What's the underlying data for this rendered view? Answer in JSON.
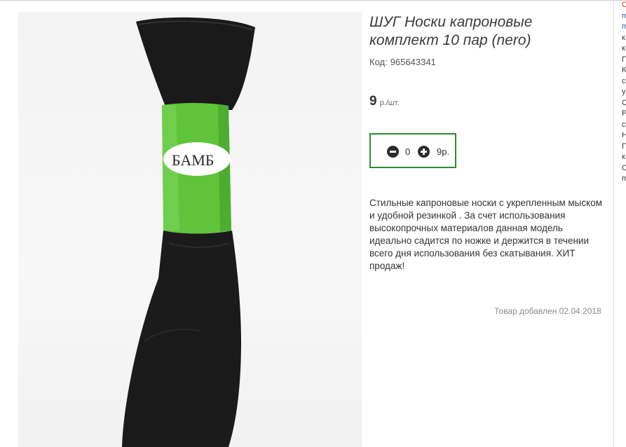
{
  "product": {
    "title": "ШУГ Носки капроновые комплект 10 пар (nero)",
    "code_label": "Код:",
    "code_value": "965643341",
    "price_value": "9",
    "price_unit": "р./шт.",
    "band_text": "БАМБ"
  },
  "cart": {
    "quantity": "0",
    "total": "9р."
  },
  "description": "Стильные капроновые носки с укрепленным мыском и удобной резинкой . За счет использования высокопрочных материалов данная модель идеально садится по ножке и держится в течении всего дня использования без скатывания. ХИТ продаж!",
  "added_text": "Товар добавлен 02.04.2018",
  "sidebar_letters": [
    "С",
    "п",
    "п",
    "к",
    "к",
    "П",
    "К",
    "с",
    "у",
    "С",
    "Р",
    "с",
    "Н",
    "П",
    "к",
    "С",
    "п"
  ],
  "colors": {
    "accent_green": "#2e8b2e",
    "band_green": "#5fc43a"
  }
}
